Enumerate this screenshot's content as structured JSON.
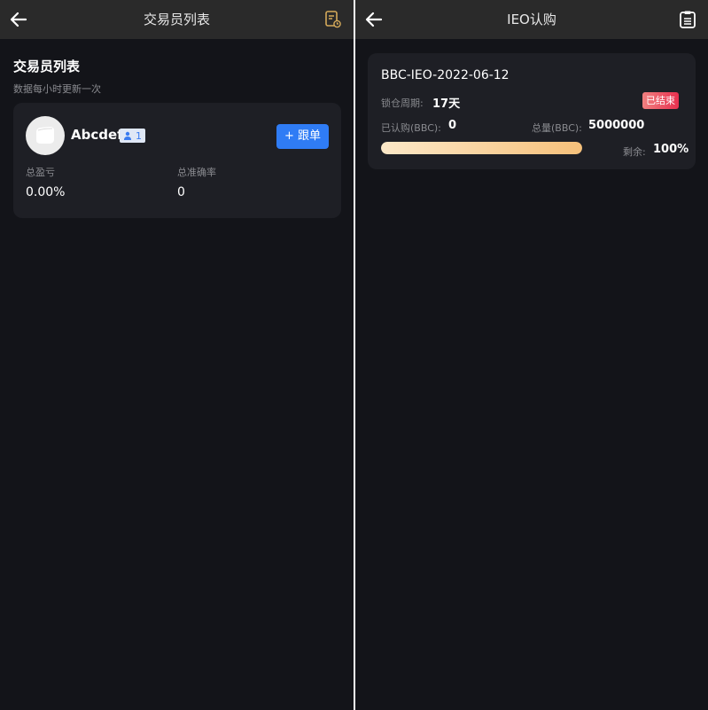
{
  "left_screen": {
    "header": {
      "title": "交易员列表"
    },
    "section": {
      "title": "交易员列表",
      "subtitle": "数据每小时更新一次"
    },
    "trader": {
      "name": "Abcdef",
      "followers": "1",
      "follow_label": "+ 跟单",
      "stats": [
        {
          "label": "总盈亏",
          "value": "0.00%"
        },
        {
          "label": "总准确率",
          "value": "0"
        }
      ]
    }
  },
  "right_screen": {
    "header": {
      "title": "IEO认购"
    },
    "ieo": {
      "name": "BBC-IEO-2022-06-12",
      "lock_label": "锁仓周期:",
      "lock_value": "17天",
      "status": "已结束",
      "subscribed_label": "已认购(BBC):",
      "subscribed_value": "0",
      "total_label": "总量(BBC):",
      "total_value": "5000000",
      "remaining_label": "剩余:",
      "remaining_value": "100%",
      "remaining_fraction": 1.0
    }
  },
  "colors": {
    "background": "#131419",
    "navbar": "#2a2a2a",
    "card": "#1e1f25",
    "accent_blue": "#2f7cf5",
    "status_red": "#e8304f",
    "progress_gold": "#f6c07a"
  }
}
